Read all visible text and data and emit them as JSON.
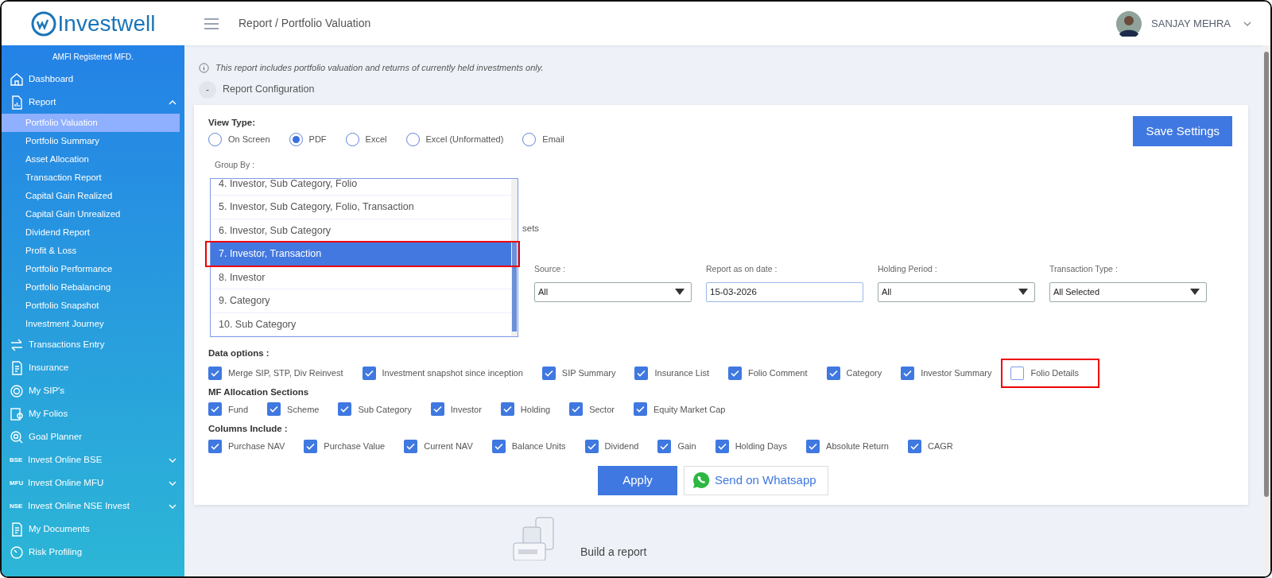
{
  "header": {
    "brand": "Investwell",
    "breadcrumb": "Report / Portfolio Valuation",
    "user": "SANJAY MEHRA"
  },
  "sidebar": {
    "caption": "AMFI Registered MFD.",
    "items": [
      {
        "label": "Dashboard",
        "kind": "home"
      },
      {
        "label": "Report",
        "kind": "report",
        "expanded": true,
        "children": [
          {
            "label": "Portfolio Valuation",
            "selected": true
          },
          {
            "label": "Portfolio Summary",
            "selected": false
          },
          {
            "label": "Asset Allocation",
            "selected": false
          },
          {
            "label": "Transaction Report",
            "selected": false
          },
          {
            "label": "Capital Gain Realized",
            "selected": false
          },
          {
            "label": "Capital Gain Unrealized",
            "selected": false
          },
          {
            "label": "Dividend Report",
            "selected": false
          },
          {
            "label": "Profit & Loss",
            "selected": false
          },
          {
            "label": "Portfolio Performance",
            "selected": false
          },
          {
            "label": "Portfolio Rebalancing",
            "selected": false
          },
          {
            "label": "Portfolio Snapshot",
            "selected": false
          },
          {
            "label": "Investment Journey",
            "selected": false
          }
        ]
      },
      {
        "label": "Transactions Entry",
        "kind": "arrows"
      },
      {
        "label": "Insurance",
        "kind": "doc"
      },
      {
        "label": "My SIP's",
        "kind": "sip"
      },
      {
        "label": "My Folios",
        "kind": "folio"
      },
      {
        "label": "Goal Planner",
        "kind": "goal"
      },
      {
        "label": "Invest Online BSE",
        "icon_text": "BSE",
        "expanded": false
      },
      {
        "label": "Invest Online MFU",
        "icon_text": "MFU",
        "expanded": false
      },
      {
        "label": "Invest Online NSE Invest",
        "icon_text": "NSE",
        "expanded": false
      },
      {
        "label": "My Documents",
        "kind": "doc"
      },
      {
        "label": "Risk Profiling",
        "kind": "gauge"
      }
    ]
  },
  "notice": "This report includes portfolio valuation and returns of currently held investments only.",
  "config_toggle": {
    "symbol": "-",
    "label": "Report Configuration"
  },
  "view_type": {
    "label": "View Type:",
    "options": [
      {
        "label": "On Screen",
        "selected": false
      },
      {
        "label": "PDF",
        "selected": true
      },
      {
        "label": "Excel",
        "selected": false
      },
      {
        "label": "Excel (Unformatted)",
        "selected": false
      },
      {
        "label": "Email",
        "selected": false
      }
    ]
  },
  "save_button": "Save Settings",
  "group_by": {
    "label": "Group By :",
    "options": [
      {
        "label": "4. Investor, Sub Category, Folio",
        "selected": false
      },
      {
        "label": "5. Investor, Sub Category, Folio, Transaction",
        "selected": false
      },
      {
        "label": "6. Investor, Sub Category",
        "selected": false
      },
      {
        "label": "7. Investor, Transaction",
        "selected": true,
        "highlighted": true
      },
      {
        "label": "8. Investor",
        "selected": false
      },
      {
        "label": "9. Category",
        "selected": false
      },
      {
        "label": "10. Sub Category",
        "selected": false
      }
    ]
  },
  "hidden_fragment": "sets",
  "filters": [
    {
      "label": "Source :",
      "value": "All",
      "kind": "select"
    },
    {
      "label": "Report as on date :",
      "value": "15-03-2026",
      "kind": "date"
    },
    {
      "label": "Holding Period :",
      "value": "All",
      "kind": "select"
    },
    {
      "label": "Transaction Type :",
      "value": "All Selected",
      "kind": "select"
    }
  ],
  "sections": [
    {
      "title": "Data options :",
      "options": [
        {
          "label": "Merge SIP, STP, Div Reinvest",
          "checked": true
        },
        {
          "label": "Investment snapshot since inception",
          "checked": true
        },
        {
          "label": "SIP Summary",
          "checked": true
        },
        {
          "label": "Insurance List",
          "checked": true
        },
        {
          "label": "Folio Comment",
          "checked": true
        },
        {
          "label": "Category",
          "checked": true
        },
        {
          "label": "Investor Summary",
          "checked": true
        },
        {
          "label": "Folio Details",
          "checked": false,
          "highlighted": true
        }
      ]
    },
    {
      "title": "MF Allocation Sections",
      "options": [
        {
          "label": "Fund",
          "checked": true
        },
        {
          "label": "Scheme",
          "checked": true
        },
        {
          "label": "Sub Category",
          "checked": true
        },
        {
          "label": "Investor",
          "checked": true
        },
        {
          "label": "Holding",
          "checked": true
        },
        {
          "label": "Sector",
          "checked": true
        },
        {
          "label": "Equity Market Cap",
          "checked": true
        }
      ]
    },
    {
      "title": "Columns Include :",
      "options": [
        {
          "label": "Purchase NAV",
          "checked": true
        },
        {
          "label": "Purchase Value",
          "checked": true
        },
        {
          "label": "Current NAV",
          "checked": true
        },
        {
          "label": "Balance Units",
          "checked": true
        },
        {
          "label": "Dividend",
          "checked": true
        },
        {
          "label": "Gain",
          "checked": true
        },
        {
          "label": "Holding Days",
          "checked": true
        },
        {
          "label": "Absolute Return",
          "checked": true
        },
        {
          "label": "CAGR",
          "checked": true
        }
      ]
    }
  ],
  "apply_button": "Apply",
  "whatsapp_button": "Send on Whatsapp",
  "empty_state": "Build a report"
}
